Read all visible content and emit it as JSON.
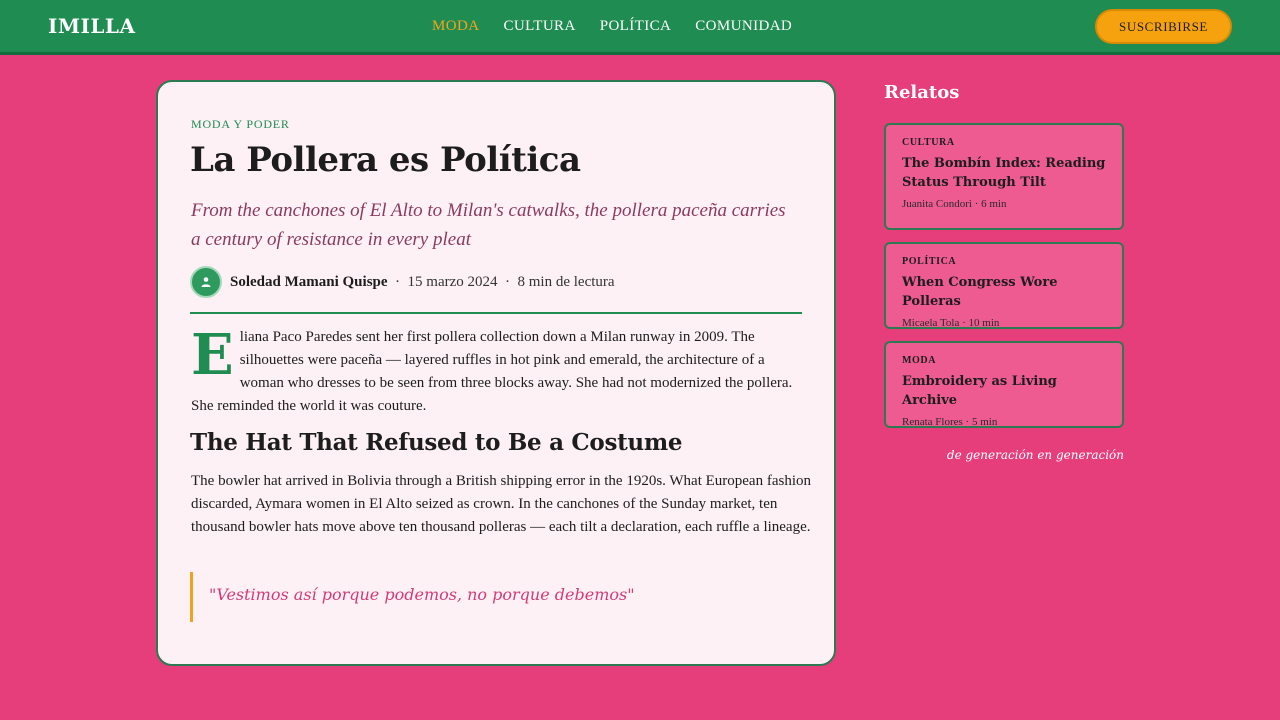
{
  "header": {
    "logo": "IMILLA",
    "nav": [
      "MODA",
      "CULTURA",
      "POLÍTICA",
      "COMUNIDAD"
    ],
    "active_nav": "MODA",
    "subscribe_label": "SUSCRIBIRSE"
  },
  "article": {
    "kicker": "MODA Y PODER",
    "title": "La Pollera es Política",
    "dek": "From the canchones of El Alto to Milan's catwalks, the pollera paceña carries a century of resistance in every pleat",
    "author": "Soledad Mamani Quispe",
    "date": "15 marzo 2024",
    "read_time": "8 min de lectura",
    "dropcap": "E",
    "para1": "liana Paco Paredes sent her first pollera collection down a Milan runway in 2009. The silhouettes were paceña — layered ruffles in hot pink and emerald, the architecture of a woman who dresses to be seen from three blocks away. She had not modernized the pollera. She reminded the world it was couture.",
    "heading2": "The Hat That Refused to Be a Costume",
    "para2": "The bowler hat arrived in Bolivia through a British shipping error in the 1920s. What European fashion discarded, Aymara women in El Alto seized as crown. In the canchones of the Sunday market, ten thousand bowler hats move above ten thousand polleras — each tilt a declaration, each ruffle a lineage.",
    "quote": "\"Vestimos así porque podemos, no porque debemos\""
  },
  "sidebar": {
    "title": "Relatos",
    "stories": [
      {
        "category": "CULTURA",
        "title": "The Bombín Index: Reading Status Through Tilt",
        "meta": "Juanita Condori · 6 min"
      },
      {
        "category": "POLÍTICA",
        "title": "When Congress Wore Polleras",
        "meta": "Micaela Tola · 10 min"
      },
      {
        "category": "MODA",
        "title": "Embroidery as Living Archive",
        "meta": "Renata Flores · 5 min"
      }
    ],
    "tagline": "de generación en generación"
  },
  "colors": {
    "background": "#e63e7a",
    "header": "#1f8c52",
    "accent": "#f6a20f",
    "card": "#fdf1f5",
    "sidebar_card": "#ee5b90"
  },
  "icons": {
    "author_avatar": "user-icon"
  }
}
